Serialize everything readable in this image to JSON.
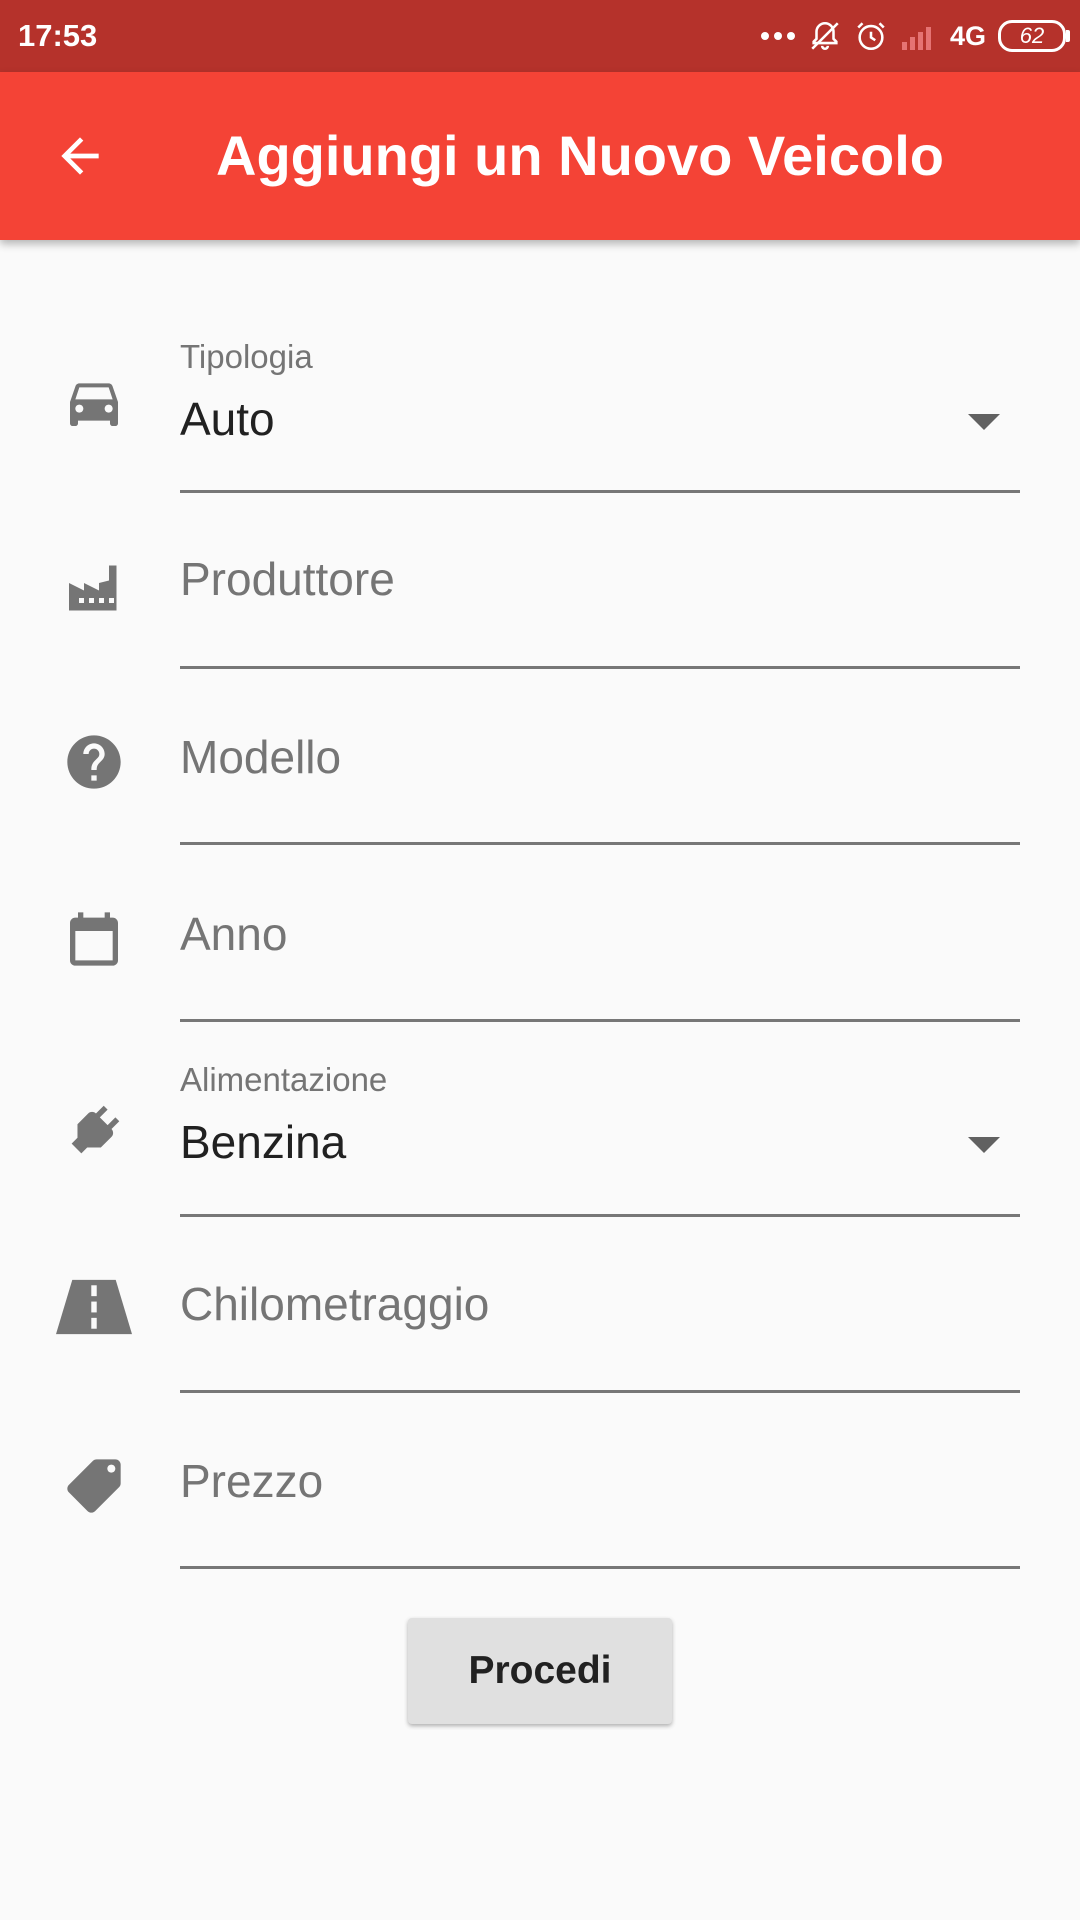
{
  "status_bar": {
    "time": "17:53",
    "network": "4G",
    "battery": "62",
    "icons": [
      "more-dots-icon",
      "notifications-off-icon",
      "alarm-icon",
      "signal-icon"
    ]
  },
  "app_bar": {
    "title": "Aggiungi un Nuovo Veicolo",
    "back_icon": "arrow-back-icon"
  },
  "form": {
    "tipologia": {
      "label": "Tipologia",
      "value": "Auto",
      "icon": "car-icon"
    },
    "produttore": {
      "placeholder": "Produttore",
      "icon": "factory-icon"
    },
    "modello": {
      "placeholder": "Modello",
      "icon": "help-circle-icon"
    },
    "anno": {
      "placeholder": "Anno",
      "icon": "calendar-icon"
    },
    "alimentazione": {
      "label": "Alimentazione",
      "value": "Benzina",
      "icon": "fuel-plug-icon"
    },
    "chilometraggio": {
      "placeholder": "Chilometraggio",
      "icon": "road-icon"
    },
    "prezzo": {
      "placeholder": "Prezzo",
      "icon": "price-tag-icon"
    }
  },
  "actions": {
    "submit_label": "Procedi"
  },
  "colors": {
    "status_bar": "#b5322b",
    "app_bar": "#f44336",
    "background": "#fafafa",
    "icon_gray": "#757575",
    "button_bg": "#e0e0e0"
  }
}
